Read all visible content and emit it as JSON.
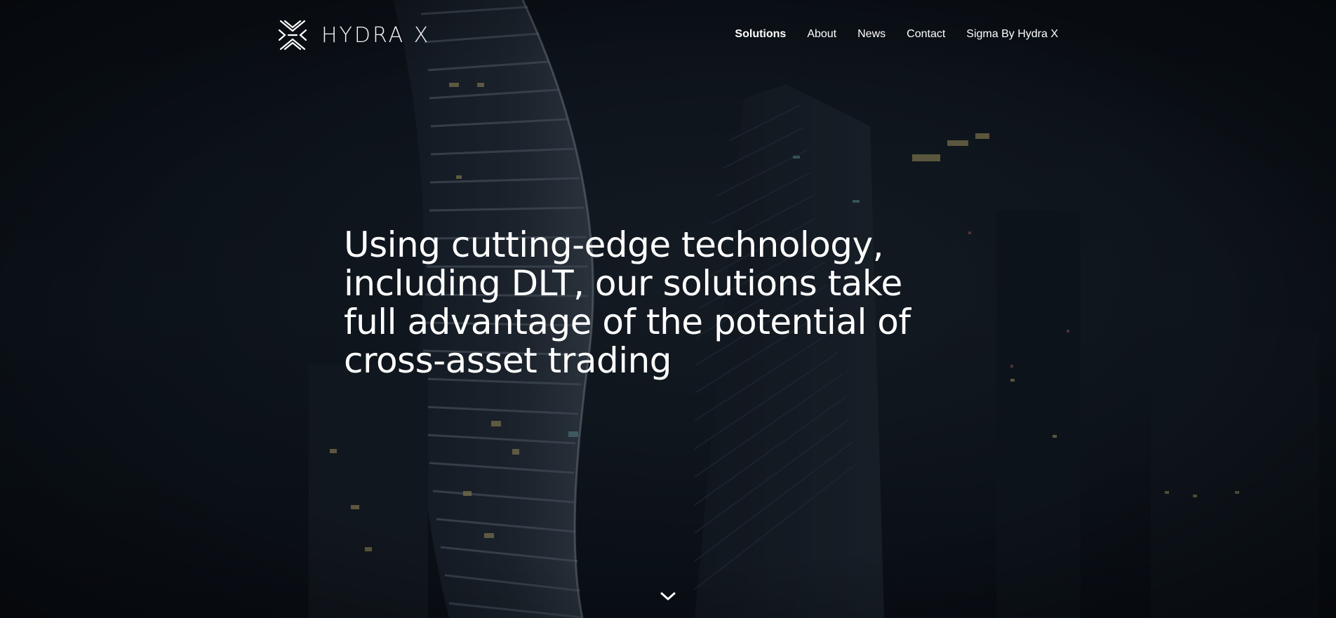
{
  "brand": {
    "name": "HYDRA X",
    "logo_icon": "hydra-x-mark"
  },
  "nav": {
    "items": [
      {
        "label": "Solutions",
        "active": true
      },
      {
        "label": "About",
        "active": false
      },
      {
        "label": "News",
        "active": false
      },
      {
        "label": "Contact",
        "active": false
      },
      {
        "label": "Sigma By Hydra X",
        "active": false
      }
    ]
  },
  "hero": {
    "headline": "Using cutting-edge technology, including DLT, our solutions take full advantage of the potential of cross-asset trading"
  },
  "scroll": {
    "icon": "chevron-down-icon"
  },
  "colors": {
    "background": "#0c1119",
    "text": "#ffffff",
    "building": "#3a4352"
  }
}
